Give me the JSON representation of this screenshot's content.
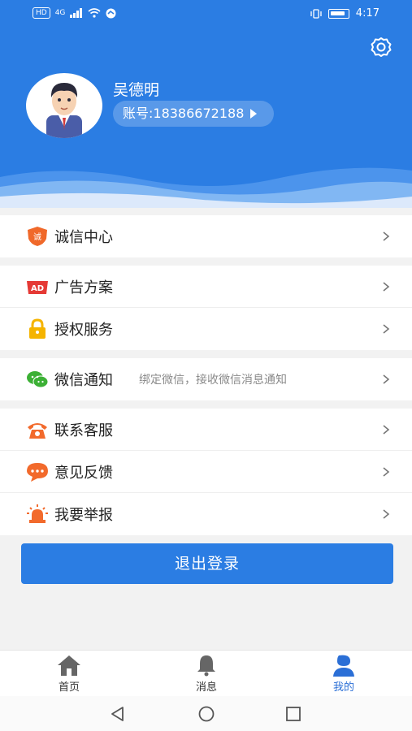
{
  "status_bar": {
    "left_badge": "HD",
    "network": "4G",
    "time": "4:17"
  },
  "profile": {
    "name": "吴德明",
    "account_label": "账号:18386672188"
  },
  "menu": {
    "group1": [
      {
        "label": "诚信中心",
        "icon": "credit-shield-icon"
      }
    ],
    "group2": [
      {
        "label": "广告方案",
        "icon": "ad-icon"
      },
      {
        "label": "授权服务",
        "icon": "lock-icon"
      }
    ],
    "group3": [
      {
        "label": "微信通知",
        "hint": "绑定微信，接收微信消息通知",
        "icon": "wechat-icon"
      }
    ],
    "group4": [
      {
        "label": "联系客服",
        "icon": "phone-icon"
      },
      {
        "label": "意见反馈",
        "icon": "chat-bubble-icon"
      },
      {
        "label": "我要举报",
        "icon": "alarm-light-icon"
      }
    ]
  },
  "logout_label": "退出登录",
  "tabs": [
    {
      "label": "首页",
      "icon": "home-icon"
    },
    {
      "label": "消息",
      "icon": "bell-icon"
    },
    {
      "label": "我的",
      "icon": "user-icon",
      "active": true
    }
  ],
  "colors": {
    "primary": "#2b7de3",
    "credit_orange": "#f0692a",
    "ad_red": "#e53935",
    "lock_yellow": "#f5b400",
    "wechat_green": "#3cb035",
    "service_orange": "#f26a2c"
  }
}
